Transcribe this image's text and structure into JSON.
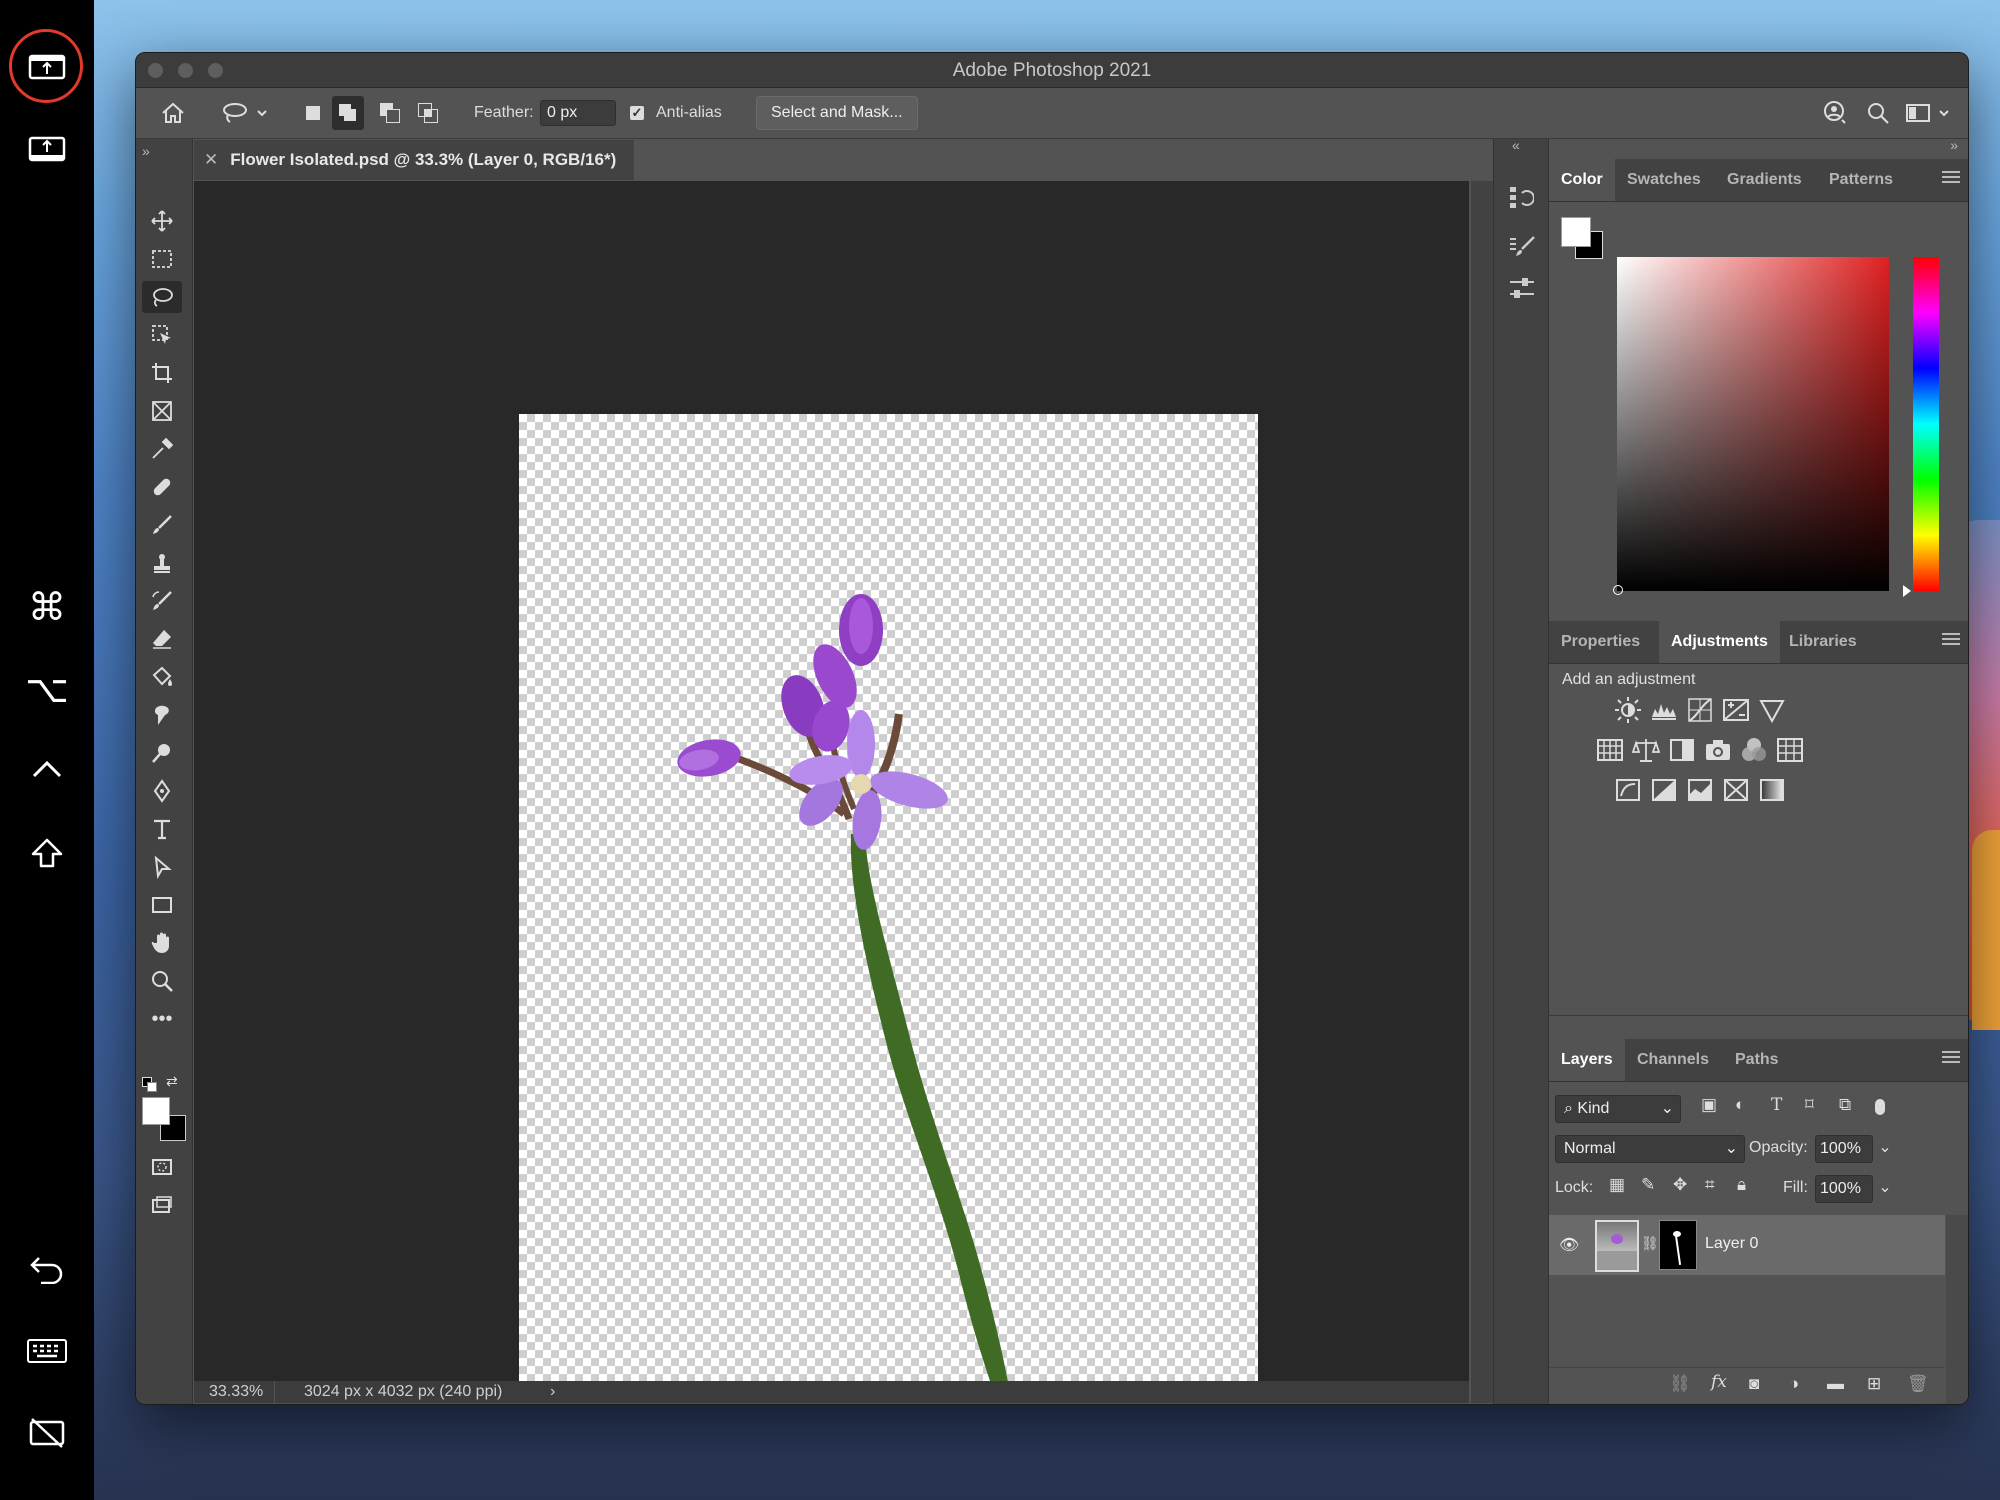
{
  "app": {
    "title": "Adobe Photoshop 2021"
  },
  "options_bar": {
    "feather_label": "Feather:",
    "feather_value": "0 px",
    "antialias_label": "Anti-alias",
    "antialias_checked": true,
    "select_mask_label": "Select and Mask..."
  },
  "document": {
    "tab_label": "Flower Isolated.psd @ 33.3% (Layer 0, RGB/16*)",
    "zoom": "33.33%",
    "info": "3024 px x 4032 px (240 ppi)"
  },
  "color_panel": {
    "tabs": [
      "Color",
      "Swatches",
      "Gradients",
      "Patterns"
    ],
    "active": "Color",
    "foreground": "#ffffff",
    "background": "#000000",
    "hue_color": "#e02020"
  },
  "adjust_panel": {
    "tabs": [
      "Properties",
      "Adjustments",
      "Libraries"
    ],
    "active": "Adjustments",
    "heading": "Add an adjustment",
    "icons": [
      "brightness-contrast-icon",
      "levels-icon",
      "curves-icon",
      "exposure-icon",
      "vibrance-icon",
      "hue-saturation-icon",
      "color-balance-icon",
      "black-white-icon",
      "photo-filter-icon",
      "channel-mixer-icon",
      "color-lookup-icon",
      "invert-icon",
      "posterize-icon",
      "threshold-icon",
      "selective-color-icon",
      "gradient-map-icon"
    ]
  },
  "layers_panel": {
    "tabs": [
      "Layers",
      "Channels",
      "Paths"
    ],
    "active": "Layers",
    "filter_kind": "Kind",
    "blend_mode": "Normal",
    "opacity_label": "Opacity:",
    "opacity_value": "100%",
    "lock_label": "Lock:",
    "fill_label": "Fill:",
    "fill_value": "100%",
    "layers": [
      {
        "name": "Layer 0",
        "visible": true
      }
    ]
  },
  "colors": {
    "accent_ring": "#e33a2c",
    "flower": "#a35bd6",
    "stem": "#3f6b24"
  }
}
